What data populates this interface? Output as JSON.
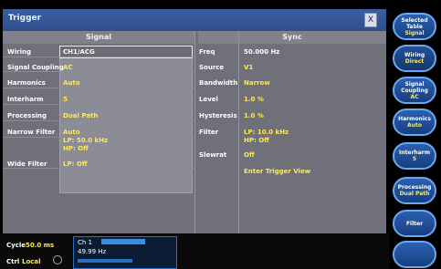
{
  "window": {
    "title": "Trigger",
    "close_label": "X"
  },
  "panel": {
    "signal_header": "Signal",
    "sync_header": "Sync",
    "signal_rows": [
      {
        "label": "Wiring",
        "value": "CH1/ACG"
      },
      {
        "label": "Signal Coupling",
        "value": "AC"
      },
      {
        "label": "Harmonics",
        "value": "Auto"
      },
      {
        "label": "Interharm",
        "value": "5"
      },
      {
        "label": "Processing",
        "value": "Dual Path"
      },
      {
        "label": "Narrow Filter",
        "value": "Auto"
      },
      {
        "label": "",
        "value": "LP: 50.0 kHz"
      },
      {
        "label": "",
        "value": "HP: Off"
      },
      {
        "label": "Wide Filter",
        "value": "LP: Off"
      }
    ],
    "sync_rows": [
      {
        "label": "Freq",
        "value": "50.000 Hz"
      },
      {
        "label": "Source",
        "value": "V1"
      },
      {
        "label": "Bandwidth",
        "value": "Narrow"
      },
      {
        "label": "Level",
        "value": "1.0 %"
      },
      {
        "label": "Hysteresis",
        "value": "1.0 %"
      },
      {
        "label": "Filter",
        "value": "LP: 10.0 kHz"
      },
      {
        "label": "",
        "value": "HP: Off"
      },
      {
        "label": "Slewrat",
        "value": "Off"
      },
      {
        "label": "",
        "value": "Enter Trigger View"
      }
    ]
  },
  "bottom": {
    "cycle_label": "Cycle",
    "cycle_value": "50.0 ms",
    "ctrl_label": "Ctrl",
    "ctrl_value": "Local",
    "meas_line1": "Ch 1",
    "meas_line2": "49.99   Hz",
    "meas_line3": "",
    "progress_fraction": 0.62
  },
  "softkeys": [
    {
      "label": "Selected",
      "label2": "Table",
      "value": "Signal"
    },
    {
      "label": "Wiring",
      "label2": "",
      "value": "Direct"
    },
    {
      "label": "Signal",
      "label2": "Coupling",
      "value": "AC"
    },
    {
      "label": "Harmonics",
      "label2": "",
      "value": "Auto"
    },
    {
      "label": "Interharm",
      "label2": "",
      "value": "5"
    },
    {
      "label": "Processing",
      "label2": "",
      "value": "Dual Path"
    },
    {
      "label": "Filter",
      "label2": "",
      "value": ""
    },
    {
      "label": "",
      "label2": "",
      "value": ""
    }
  ]
}
